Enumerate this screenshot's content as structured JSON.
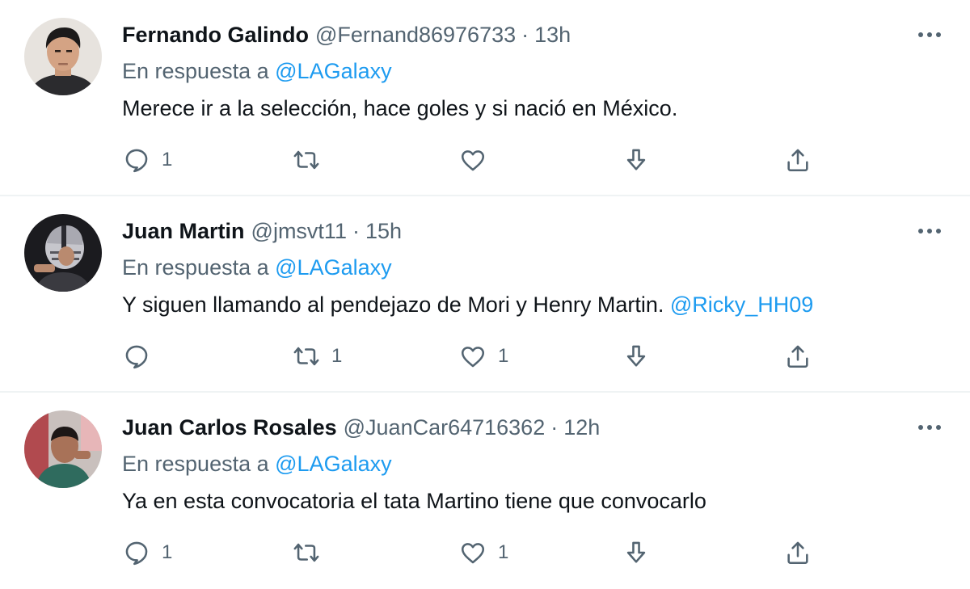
{
  "reply_prefix": "En respuesta a",
  "tweets": [
    {
      "name": "Fernando Galindo",
      "handle": "@Fernand86976733",
      "separator": "·",
      "time": "13h",
      "reply_to": "@LAGalaxy",
      "text": "Merece ir a la selección, hace goles y si nació en México.",
      "mention": "",
      "replies": "1",
      "retweets": "",
      "likes": ""
    },
    {
      "name": "Juan Martin",
      "handle": "@jmsvt11",
      "separator": "·",
      "time": "15h",
      "reply_to": "@LAGalaxy",
      "text": "Y siguen llamando al pendejazo de Mori y Henry Martin. ",
      "mention": "@Ricky_HH09",
      "replies": "",
      "retweets": "1",
      "likes": "1"
    },
    {
      "name": "Juan Carlos Rosales",
      "handle": "@JuanCar64716362",
      "separator": "·",
      "time": "12h",
      "reply_to": "@LAGalaxy",
      "text": "Ya en esta convocatoria el tata Martino tiene que convocarlo",
      "mention": "",
      "replies": "1",
      "retweets": "",
      "likes": "1"
    }
  ],
  "icons": {
    "more": "more-horizontal-icon",
    "reply": "speech-bubble-icon",
    "retweet": "retweet-arrows-icon",
    "like": "heart-icon",
    "download": "download-arrow-icon",
    "share": "share-upload-icon"
  },
  "colors": {
    "text": "#0f1419",
    "secondary": "#536471",
    "link": "#1d9bf0",
    "divider": "#eff3f4"
  }
}
